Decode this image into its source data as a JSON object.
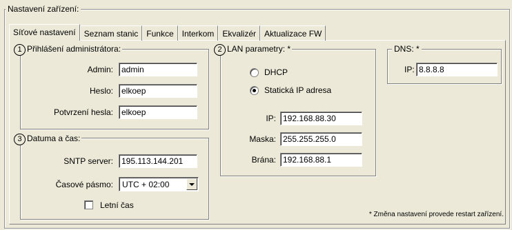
{
  "outer_group": {
    "title": "Nastavení zařízení:"
  },
  "tabs": [
    {
      "label": "Síťové nastavení",
      "active": true
    },
    {
      "label": "Seznam stanic",
      "active": false
    },
    {
      "label": "Funkce",
      "active": false
    },
    {
      "label": "Interkom",
      "active": false
    },
    {
      "label": "Ekvalizér",
      "active": false
    },
    {
      "label": "Aktualizace FW",
      "active": false
    }
  ],
  "admin": {
    "number": "1",
    "title": "Přihlášení administrátora:",
    "admin_label": "Admin:",
    "admin_value": "admin",
    "password_label": "Heslo:",
    "password_value": "elkoep",
    "confirm_label": "Potvrzení hesla:",
    "confirm_value": "elkoep"
  },
  "lan": {
    "number": "2",
    "title": "LAN parametry: *",
    "dhcp_label": "DHCP",
    "static_label": "Statická IP adresa",
    "selected": "static",
    "ip_label": "IP:",
    "ip_value": "192.168.88.30",
    "mask_label": "Maska:",
    "mask_value": "255.255.255.0",
    "gateway_label": "Brána:",
    "gateway_value": "192.168.88.1"
  },
  "dns": {
    "title": "DNS: *",
    "ip_label": "IP:",
    "ip_value": "8.8.8.8"
  },
  "datetime": {
    "number": "3",
    "title": "Datuma a čas:",
    "sntp_label": "SNTP server:",
    "sntp_value": "195.113.144.201",
    "timezone_label": "Časové pásmo:",
    "timezone_value": "UTC + 02:00",
    "dst_label": "Letní čas",
    "dst_checked": false
  },
  "footer_note": "* Změna nastavení provede restart zařízení."
}
